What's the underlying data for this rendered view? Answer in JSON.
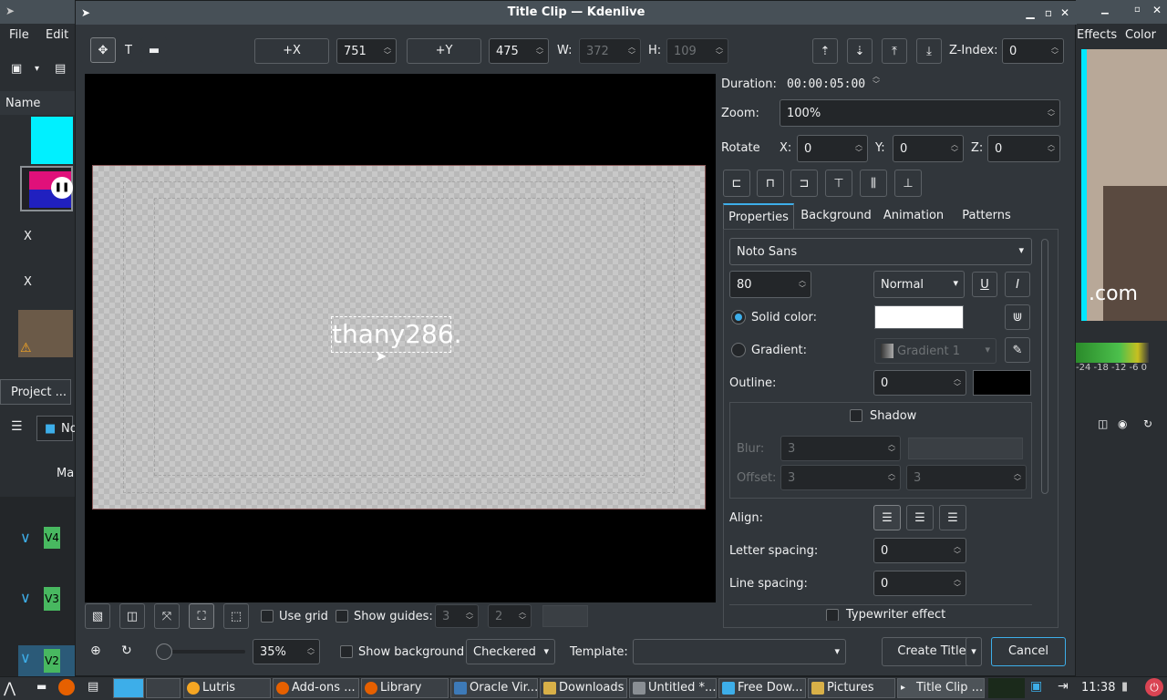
{
  "background": {
    "menu": [
      "File",
      "Edit"
    ],
    "name_header": "Name",
    "x1": "X",
    "x2": "X",
    "project_tab": "Project ...",
    "no_label": "No",
    "ma_label": "Ma",
    "tracks": [
      "V4",
      "V3",
      "V2"
    ],
    "right_tabs": [
      "Effects",
      "Color"
    ],
    "right_text": ".com",
    "vu_scale": "-24 -18 -12 -6 0"
  },
  "window": {
    "title": "Title Clip — Kdenlive"
  },
  "toolbar": {
    "plus_x": "+X",
    "x_value": "751",
    "plus_y": "+Y",
    "y_value": "475",
    "w_label": "W:",
    "w_value": "372",
    "h_label": "H:",
    "h_value": "109",
    "zindex_label": "Z-Index:",
    "zindex_value": "0"
  },
  "props": {
    "duration_label": "Duration:",
    "duration_value": "00:00:05:00",
    "zoom_label": "Zoom:",
    "zoom_value": "100%",
    "rotate_label": "Rotate",
    "rx_label": "X:",
    "rx_value": "0",
    "ry_label": "Y:",
    "ry_value": "0",
    "rz_label": "Z:",
    "rz_value": "0"
  },
  "tabs": [
    "Properties",
    "Background",
    "Animation",
    "Patterns"
  ],
  "font": {
    "family": "Noto Sans",
    "size": "80",
    "weight": "Normal"
  },
  "color": {
    "solid_label": "Solid color:",
    "solid_value": "#ffffff",
    "gradient_label": "Gradient:",
    "gradient_value": "Gradient 1"
  },
  "outline": {
    "label": "Outline:",
    "value": "0",
    "color": "#000000"
  },
  "shadow": {
    "label": "Shadow",
    "blur_label": "Blur:",
    "blur_value": "3",
    "offset_label": "Offset:",
    "offset_x": "3",
    "offset_y": "3"
  },
  "align": {
    "label": "Align:"
  },
  "spacing": {
    "letter_label": "Letter spacing:",
    "letter_value": "0",
    "line_label": "Line spacing:",
    "line_value": "0"
  },
  "typewriter": "Typewriter effect",
  "canvas": {
    "text": "thany286."
  },
  "bottom": {
    "use_grid": "Use grid",
    "show_guides": "Show guides:",
    "guides_h": "3",
    "guides_v": "2",
    "zoom_value": "35%",
    "show_background": "Show background",
    "bg_mode": "Checkered",
    "template_label": "Template:",
    "create_title": "Create Title",
    "cancel": "Cancel"
  },
  "taskbar": {
    "tasks": [
      "Lutris",
      "Add-ons ...",
      "Library",
      "Oracle Vir...",
      "Downloads",
      "Untitled *...",
      "Free Dow...",
      "Pictures",
      "Title Clip ..."
    ],
    "clock": "11:38"
  }
}
